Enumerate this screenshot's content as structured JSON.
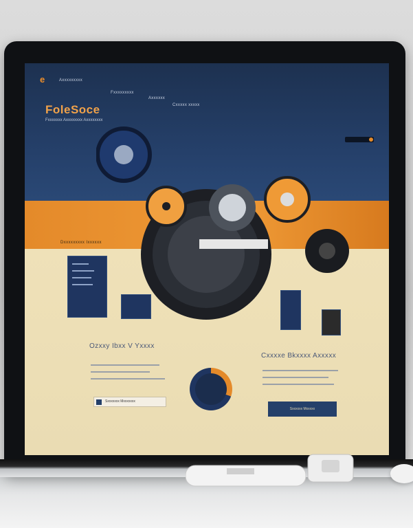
{
  "site": {
    "logo_mark": "e",
    "brand": "FoleSoce",
    "tagline": "Fxxxxxxx Axxxxxxxx Axxxxxxxx",
    "nav": [
      "Axxxxxxxxx",
      "Fxxxxxxxxx",
      "Axxxxxx",
      "Cxxxxx xxxxx"
    ]
  },
  "sections": {
    "left_title": "Ozxxy Ibxx V Yxxxx",
    "right_title": "Cxxxxe Bkxxxx Axxxxx",
    "orange_label": "Dxxxxxxxxx Ixxxxxx"
  },
  "buttons": {
    "left_button_label": "Sxxxxxxx Mxxxxxxx",
    "right_button_label": "Sxxxxxx Mxxxxx"
  },
  "colors": {
    "navy": "#25406a",
    "orange": "#e48a2a",
    "cream": "#efe1b8"
  }
}
